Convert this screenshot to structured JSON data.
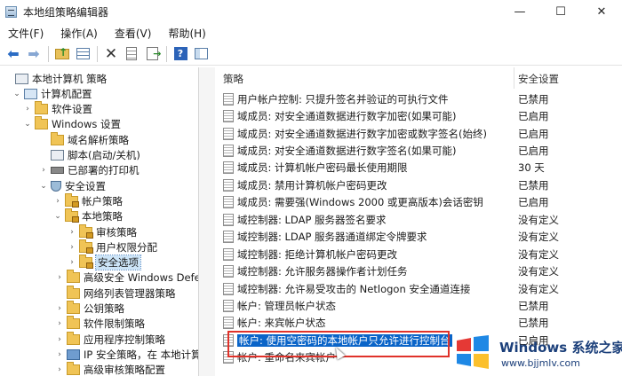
{
  "window": {
    "title": "本地组策略编辑器",
    "controls": [
      "—",
      "☐",
      "✕"
    ]
  },
  "menu": [
    "文件(F)",
    "操作(A)",
    "查看(V)",
    "帮助(H)"
  ],
  "tree": [
    {
      "label": "本地计算机 策略",
      "icon": "policy",
      "chev": ""
    },
    {
      "label": "计算机配置",
      "icon": "pc",
      "chev": "⌄"
    },
    {
      "label": "软件设置",
      "icon": "folder",
      "chev": "›"
    },
    {
      "label": "Windows 设置",
      "icon": "folder",
      "chev": "⌄"
    },
    {
      "label": "域名解析策略",
      "icon": "folder",
      "chev": ""
    },
    {
      "label": "脚本(启动/关机)",
      "icon": "policy",
      "chev": ""
    },
    {
      "label": "已部署的打印机",
      "icon": "printer",
      "chev": "›"
    },
    {
      "label": "安全设置",
      "icon": "shield",
      "chev": "⌄"
    },
    {
      "label": "帐户策略",
      "icon": "lock-folder",
      "chev": "›"
    },
    {
      "label": "本地策略",
      "icon": "lock-folder",
      "chev": "⌄"
    },
    {
      "label": "审核策略",
      "icon": "lock-folder",
      "chev": "›"
    },
    {
      "label": "用户权限分配",
      "icon": "lock-folder",
      "chev": "›"
    },
    {
      "label": "安全选项",
      "icon": "lock-folder",
      "chev": "›",
      "selected": true
    },
    {
      "label": "高级安全 Windows Defen",
      "icon": "folder",
      "chev": "›"
    },
    {
      "label": "网络列表管理器策略",
      "icon": "folder",
      "chev": ""
    },
    {
      "label": "公钥策略",
      "icon": "folder",
      "chev": "›"
    },
    {
      "label": "软件限制策略",
      "icon": "folder",
      "chev": "›"
    },
    {
      "label": "应用程序控制策略",
      "icon": "folder",
      "chev": "›"
    },
    {
      "label": "IP 安全策略，在 本地计算",
      "icon": "net",
      "chev": "›"
    },
    {
      "label": "高级审核策略配置",
      "icon": "folder",
      "chev": "›"
    }
  ],
  "list": {
    "col_policy": "策略",
    "col_setting": "安全设置",
    "rows": [
      {
        "name": "用户帐户控制: 只提升签名并验证的可执行文件",
        "state": "已禁用"
      },
      {
        "name": "域成员: 对安全通道数据进行数字加密(如果可能)",
        "state": "已启用"
      },
      {
        "name": "域成员: 对安全通道数据进行数字加密或数字签名(始终)",
        "state": "已启用"
      },
      {
        "name": "域成员: 对安全通道数据进行数字签名(如果可能)",
        "state": "已启用"
      },
      {
        "name": "域成员: 计算机帐户密码最长使用期限",
        "state": "30 天"
      },
      {
        "name": "域成员: 禁用计算机帐户密码更改",
        "state": "已禁用"
      },
      {
        "name": "域成员: 需要强(Windows 2000 或更高版本)会话密钥",
        "state": "已启用"
      },
      {
        "name": "域控制器: LDAP 服务器签名要求",
        "state": "没有定义"
      },
      {
        "name": "域控制器: LDAP 服务器通道绑定令牌要求",
        "state": "没有定义"
      },
      {
        "name": "域控制器: 拒绝计算机帐户密码更改",
        "state": "没有定义"
      },
      {
        "name": "域控制器: 允许服务器操作者计划任务",
        "state": "没有定义"
      },
      {
        "name": "域控制器:  允许易受攻击的 Netlogon 安全通道连接",
        "state": "没有定义"
      },
      {
        "name": "帐户: 管理员帐户状态",
        "state": "已禁用"
      },
      {
        "name": "帐户: 来宾帐户状态",
        "state": "已禁用"
      },
      {
        "name": "帐户: 使用空密码的本地帐户只允许进行控制台",
        "state": "已启用",
        "highlight": true
      },
      {
        "name": "帐户: 重命名来宾帐户",
        "state": ""
      }
    ]
  },
  "watermark": {
    "title": "Windows",
    "title_cn": "系统之家",
    "url": "www.bjjmlv.com"
  },
  "colors": {
    "selection": "#0a64c8",
    "annotation_box": "#e0322a",
    "watermark": "#1b3f7a"
  }
}
